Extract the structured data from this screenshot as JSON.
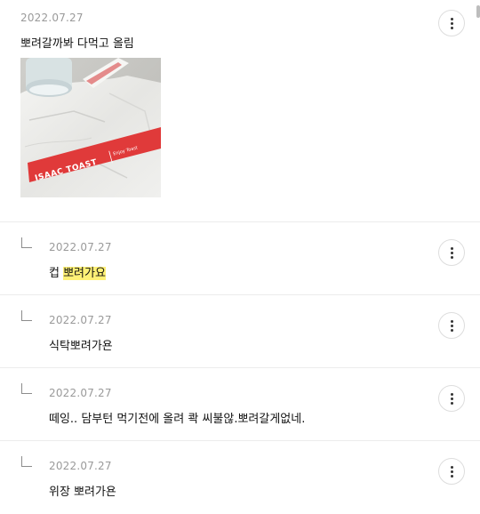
{
  "comments": [
    {
      "date": "2022.07.27",
      "text": "뽀려갈까봐 다먹고 올림"
    },
    {
      "date": "2022.07.27",
      "text_prefix": "컵 ",
      "text_highlight": "뽀려가요"
    },
    {
      "date": "2022.07.27",
      "text": "식탁뽀려가욘"
    },
    {
      "date": "2022.07.27",
      "text": "떼잉.. 담부턴 먹기전에 올려 콱 씨불않.뽀려갈게없네."
    },
    {
      "date": "2022.07.27",
      "text": "위장 뽀려가욘"
    }
  ],
  "photo": {
    "wrapper_brand": "ISAAC TOAST",
    "wrapper_sub": "Enjoy Toast"
  },
  "colors": {
    "highlight": "#fff176",
    "wrapper_red": "#e03a3a"
  },
  "icons": {
    "more": "vertical-ellipsis-icon",
    "reply": "reply-corner-icon"
  }
}
